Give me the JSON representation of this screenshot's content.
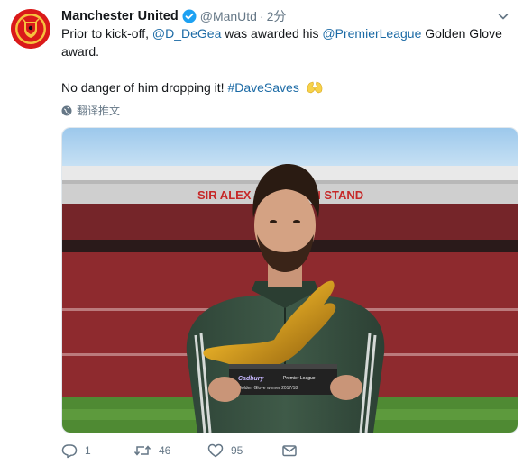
{
  "tweet": {
    "author_name": "Manchester United",
    "handle": "@ManUtd",
    "separator": "·",
    "time": "2分",
    "line1_prefix": "Prior to kick-off, ",
    "mention1": "@D_DeGea",
    "line1_middle": " was awarded his ",
    "mention2": "@PremierLeague",
    "line1_suffix": " Golden Glove award.",
    "line2_prefix": "No danger of him dropping it! ",
    "hashtag": "#DaveSaves",
    "translate_label": "翻译推文",
    "stand_text": "SIR ALEX FERGUSON STAND",
    "plaque_brand": "Cadbury",
    "plaque_league": "Premier League",
    "plaque_caption": "Golden Glove winner 2017/18"
  },
  "actions": {
    "reply_count": "1",
    "retweet_count": "46",
    "like_count": "95"
  },
  "colors": {
    "link": "#1b6aa5",
    "muted": "#657786",
    "brand_red": "#da1a1a",
    "verified_blue": "#1da1f2"
  },
  "icons": [
    "club-crest-icon",
    "verified-icon",
    "chevron-down-icon",
    "globe-icon",
    "reply-icon",
    "retweet-icon",
    "like-icon",
    "message-icon",
    "clap-emoji-icon"
  ]
}
